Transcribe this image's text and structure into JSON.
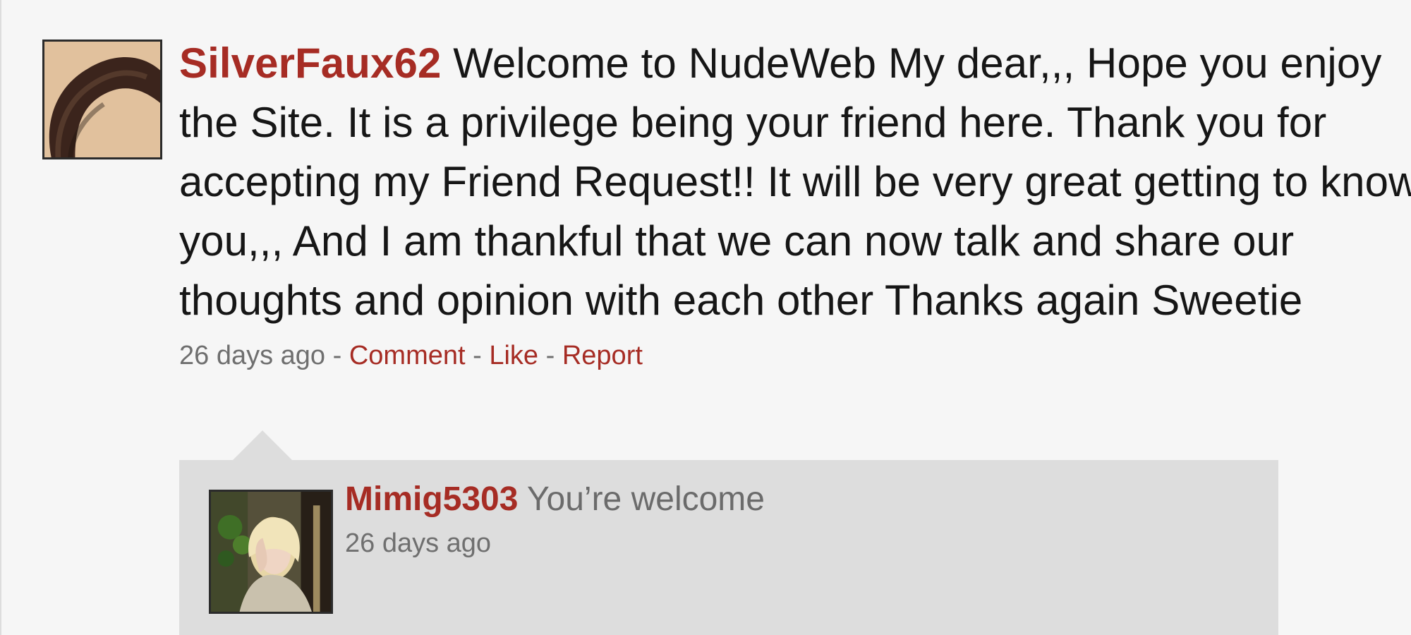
{
  "post": {
    "author": "SilverFaux62",
    "message": "Welcome to NudeWeb My dear,,, Hope you enjoy the Site. It is a privilege being your friend here. Thank you for accepting my Friend Request!! It will be very great getting to know you,,, And I am thankful that we can now talk and share our thoughts and opinion with each other Thanks again Sweetie",
    "timestamp": "26 days ago",
    "separator": "-",
    "actions": {
      "comment": "Comment",
      "like": "Like",
      "report": "Report"
    }
  },
  "reply": {
    "author": "Mimig5303",
    "message": "You’re welcome",
    "timestamp": "26 days ago"
  },
  "theme": {
    "background": "#f6f6f6",
    "reply_background": "#dddddd",
    "link_color": "#a62c24",
    "text_color": "#161616",
    "muted_text_color": "#6f6f6f"
  }
}
